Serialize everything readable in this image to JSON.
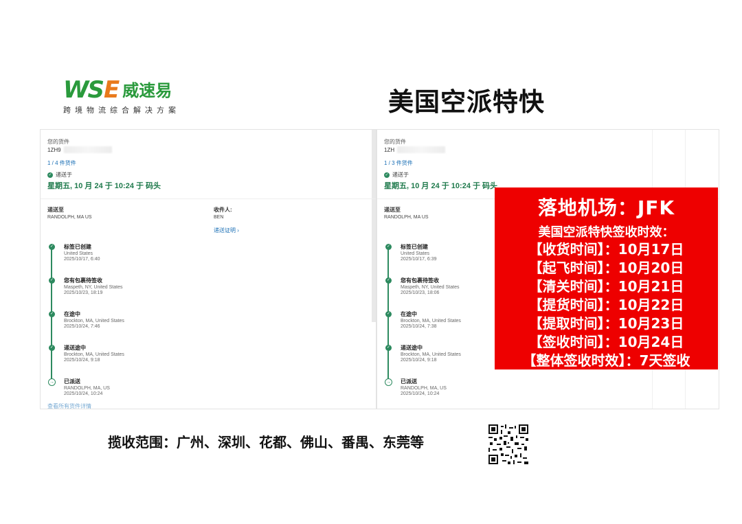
{
  "header": {
    "logo_latin_w": "WS",
    "logo_latin_e": "E",
    "logo_cn": "威速易",
    "logo_sub": "跨境物流综合解决方案",
    "title": "美国空派特快"
  },
  "panels": [
    {
      "your_shipment_label": "您的货件",
      "tracking_visible": "1ZH9",
      "package_count": "1 / 4 件货件",
      "delivered_label": "递送于",
      "delivered_date": "星期五, 10 月 24 于 10:24 于 码头",
      "ship_to_label": "递送至",
      "ship_to_value": "RANDOLPH, MA US",
      "recipient_label": "收件人:",
      "recipient_value": "BEN",
      "proof_link": "递送证明",
      "events": [
        {
          "title": "标签已创建",
          "location": "United States",
          "time": "2025/10/17, 6:40"
        },
        {
          "title": "您有包裹待签收",
          "location": "Maspeth, NY, United States",
          "time": "2025/10/23, 18:19"
        },
        {
          "title": "在途中",
          "location": "Brockton, MA, United States",
          "time": "2025/10/24, 7:46"
        },
        {
          "title": "递送途中",
          "location": "Brockton, MA, United States",
          "time": "2025/10/24, 9:18"
        },
        {
          "title": "已派送",
          "location": "RANDOLPH, MA, US",
          "time": "2025/10/24, 10:24"
        }
      ],
      "more_link": "查看所有货件详情"
    },
    {
      "your_shipment_label": "您的货件",
      "tracking_visible": "1ZH",
      "package_count": "1 / 3 件货件",
      "delivered_label": "递送于",
      "delivered_date": "星期五, 10 月 24 于 10:24 于 码头",
      "ship_to_label": "递送至",
      "ship_to_value": "RANDOLPH, MA US",
      "events": [
        {
          "title": "标签已创建",
          "location": "United States",
          "time": "2025/10/17, 6:39"
        },
        {
          "title": "您有包裹待签收",
          "location": "Maspeth, NY, United States",
          "time": "2025/10/23, 18:06"
        },
        {
          "title": "在途中",
          "location": "Brockton, MA, United States",
          "time": "2025/10/24, 7:38"
        },
        {
          "title": "递送途中",
          "location": "Brockton, MA, United States",
          "time": "2025/10/24, 9:18"
        },
        {
          "title": "已派送",
          "location": "RANDOLPH, MA, US",
          "time": "2025/10/24, 10:24"
        }
      ]
    }
  ],
  "info_box": {
    "title": "落地机场：JFK",
    "subtitle": "美国空派特快签收时效：",
    "lines": [
      "【收货时间】：10月17日",
      "【起飞时间】：10月20日",
      "【清关时间】：10月21日",
      "【提货时间】：10月22日",
      "【提取时间】：10月23日",
      "【签收时间】：10月24日",
      "【整体签收时效】：7天签收"
    ],
    "background": "#ee0000"
  },
  "footer": {
    "pickup_range": "揽收范围：广州、深圳、花都、佛山、番禺、东莞等"
  },
  "colors": {
    "brand_green": "#2a9a3c",
    "brand_orange": "#e97a1c",
    "status_green": "#1f7a4c",
    "link_blue": "#1a6fb5"
  }
}
